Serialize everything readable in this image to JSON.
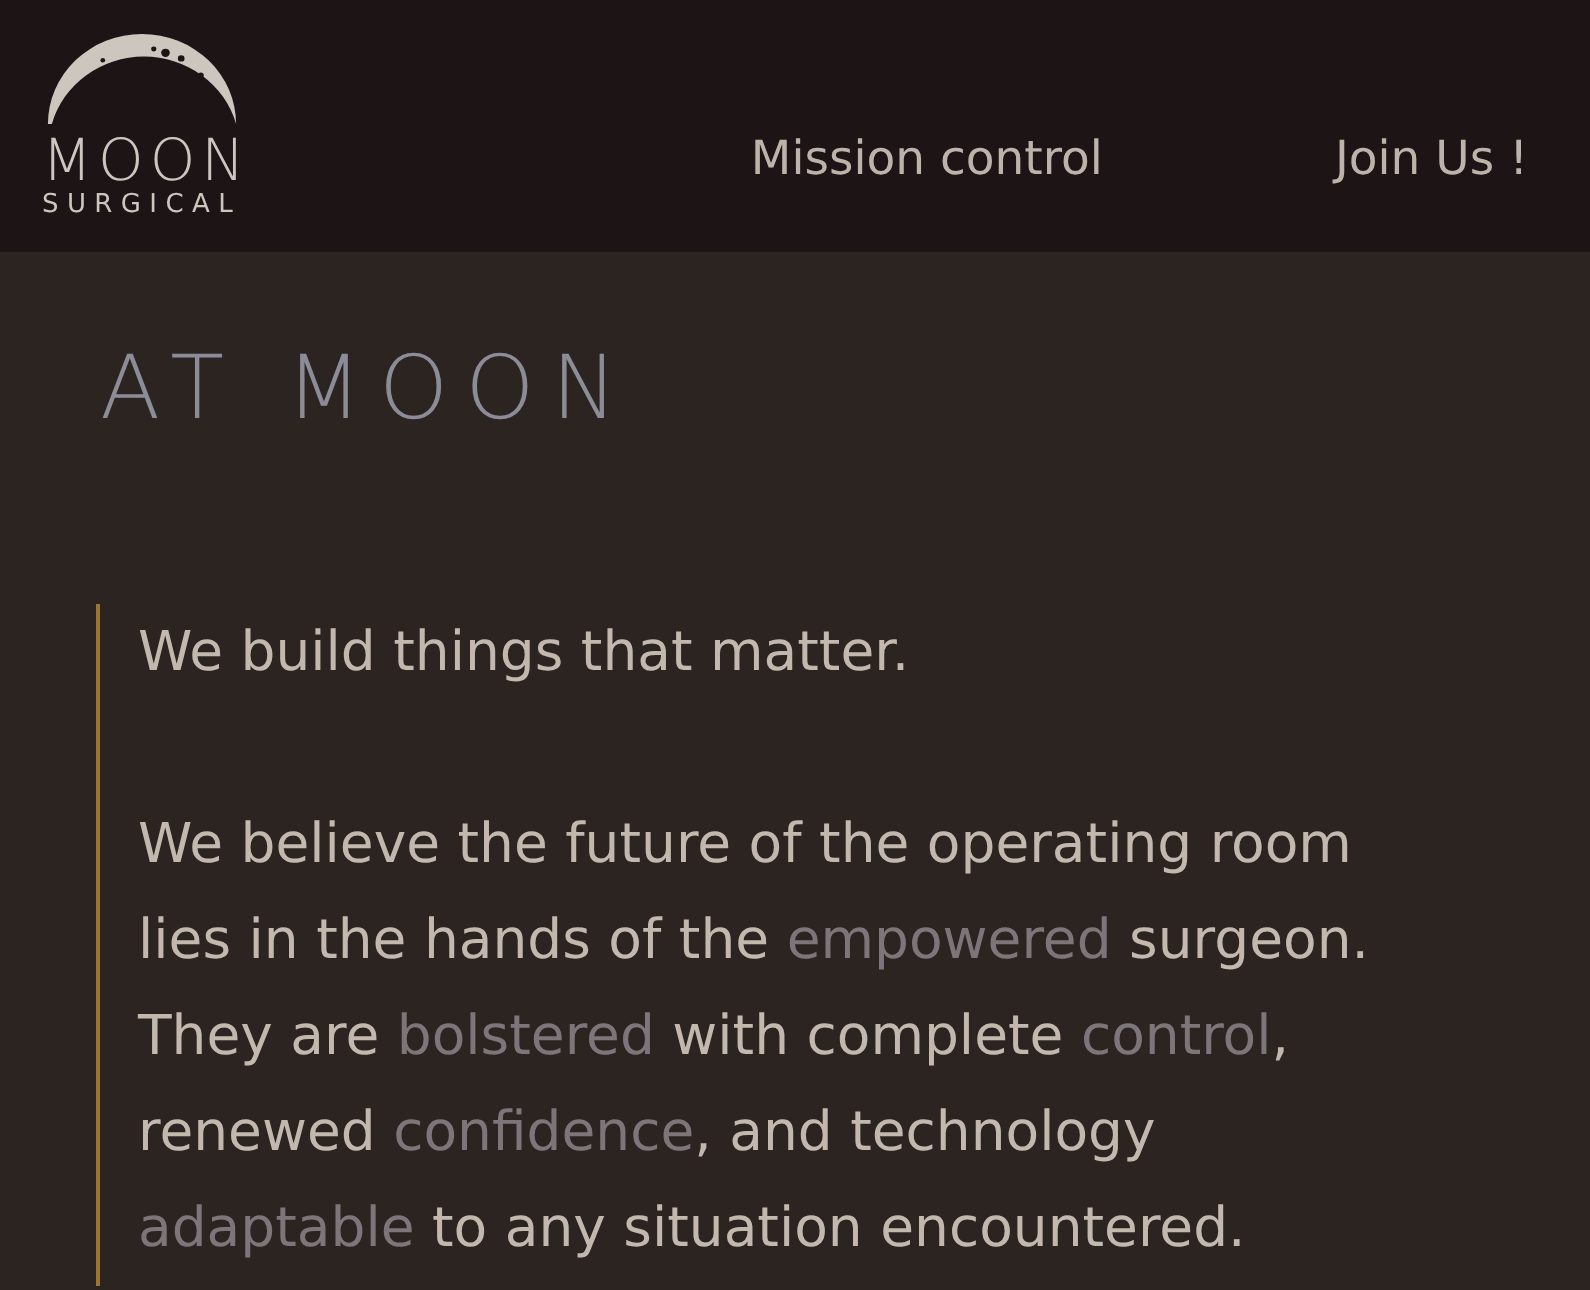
{
  "header": {
    "logo": {
      "name": "MOON",
      "subtitle": "SURGICAL"
    },
    "nav": [
      {
        "label": "Mission control"
      },
      {
        "label": "Join Us !"
      }
    ]
  },
  "about": {
    "heading": "AT MOON",
    "quote": {
      "paragraphs": [
        [
          {
            "text": "We build things that matter.",
            "highlight": false
          }
        ],
        [
          {
            "text": "We believe the future of the operating room lies in the hands of the ",
            "highlight": false
          },
          {
            "text": "empowered",
            "highlight": true
          },
          {
            "text": " surgeon. They are ",
            "highlight": false
          },
          {
            "text": "bolstered",
            "highlight": true
          },
          {
            "text": " with complete ",
            "highlight": false
          },
          {
            "text": "control",
            "highlight": true
          },
          {
            "text": ", renewed ",
            "highlight": false
          },
          {
            "text": "confidence",
            "highlight": true
          },
          {
            "text": ", and technology ",
            "highlight": false
          },
          {
            "text": "adaptable",
            "highlight": true
          },
          {
            "text": " to any situation encountered.",
            "highlight": false
          }
        ]
      ]
    }
  }
}
